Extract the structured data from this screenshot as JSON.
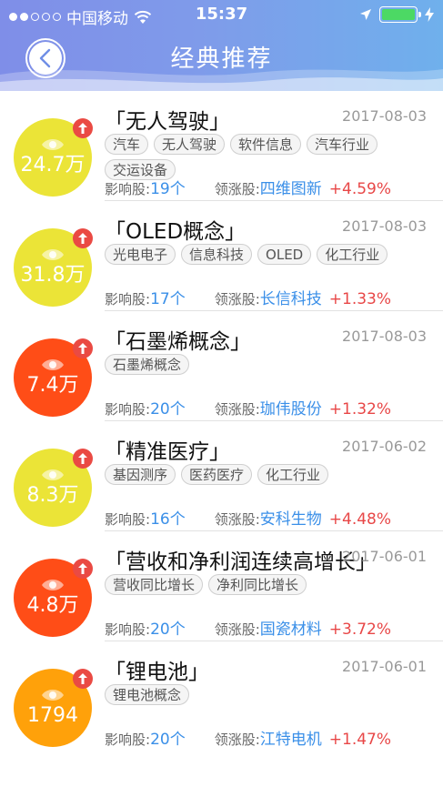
{
  "status": {
    "carrier": "中国移动",
    "time": "15:37"
  },
  "header": {
    "title": "经典推荐"
  },
  "labels": {
    "influence": "影响股:",
    "leader": "领涨股:"
  },
  "colors": {
    "yellow": "#ebe437",
    "orange_red": "#ff4d17",
    "orange": "#ffa10a",
    "badge": "#ea4a43",
    "link": "#3a8fe8",
    "up": "#e84747"
  },
  "items": [
    {
      "title": "「无人驾驶」",
      "date": "2017-08-03",
      "views": "24.7万",
      "tags": [
        "汽车",
        "无人驾驶",
        "软件信息",
        "汽车行业",
        "交运设备"
      ],
      "count": "19个",
      "leader": "四维图新",
      "change": "+4.59%",
      "color": "yellow"
    },
    {
      "title": "「OLED概念」",
      "date": "2017-08-03",
      "views": "31.8万",
      "tags": [
        "光电电子",
        "信息科技",
        "OLED",
        "化工行业"
      ],
      "count": "17个",
      "leader": "长信科技",
      "change": "+1.33%",
      "color": "yellow"
    },
    {
      "title": "「石墨烯概念」",
      "date": "2017-08-03",
      "views": "7.4万",
      "tags": [
        "石墨烯概念"
      ],
      "count": "20个",
      "leader": "珈伟股份",
      "change": "+1.32%",
      "color": "orange_red"
    },
    {
      "title": "「精准医疗」",
      "date": "2017-06-02",
      "views": "8.3万",
      "tags": [
        "基因测序",
        "医药医疗",
        "化工行业"
      ],
      "count": "16个",
      "leader": "安科生物",
      "change": "+4.48%",
      "color": "yellow"
    },
    {
      "title": "「营收和净利润连续高增长」",
      "date": "2017-06-01",
      "views": "4.8万",
      "tags": [
        "营收同比增长",
        "净利同比增长"
      ],
      "count": "20个",
      "leader": "国瓷材料",
      "change": "+3.72%",
      "color": "orange_red"
    },
    {
      "title": "「锂电池」",
      "date": "2017-06-01",
      "views": "1794",
      "tags": [
        "锂电池概念"
      ],
      "count": "20个",
      "leader": "江特电机",
      "change": "+1.47%",
      "color": "orange"
    }
  ]
}
